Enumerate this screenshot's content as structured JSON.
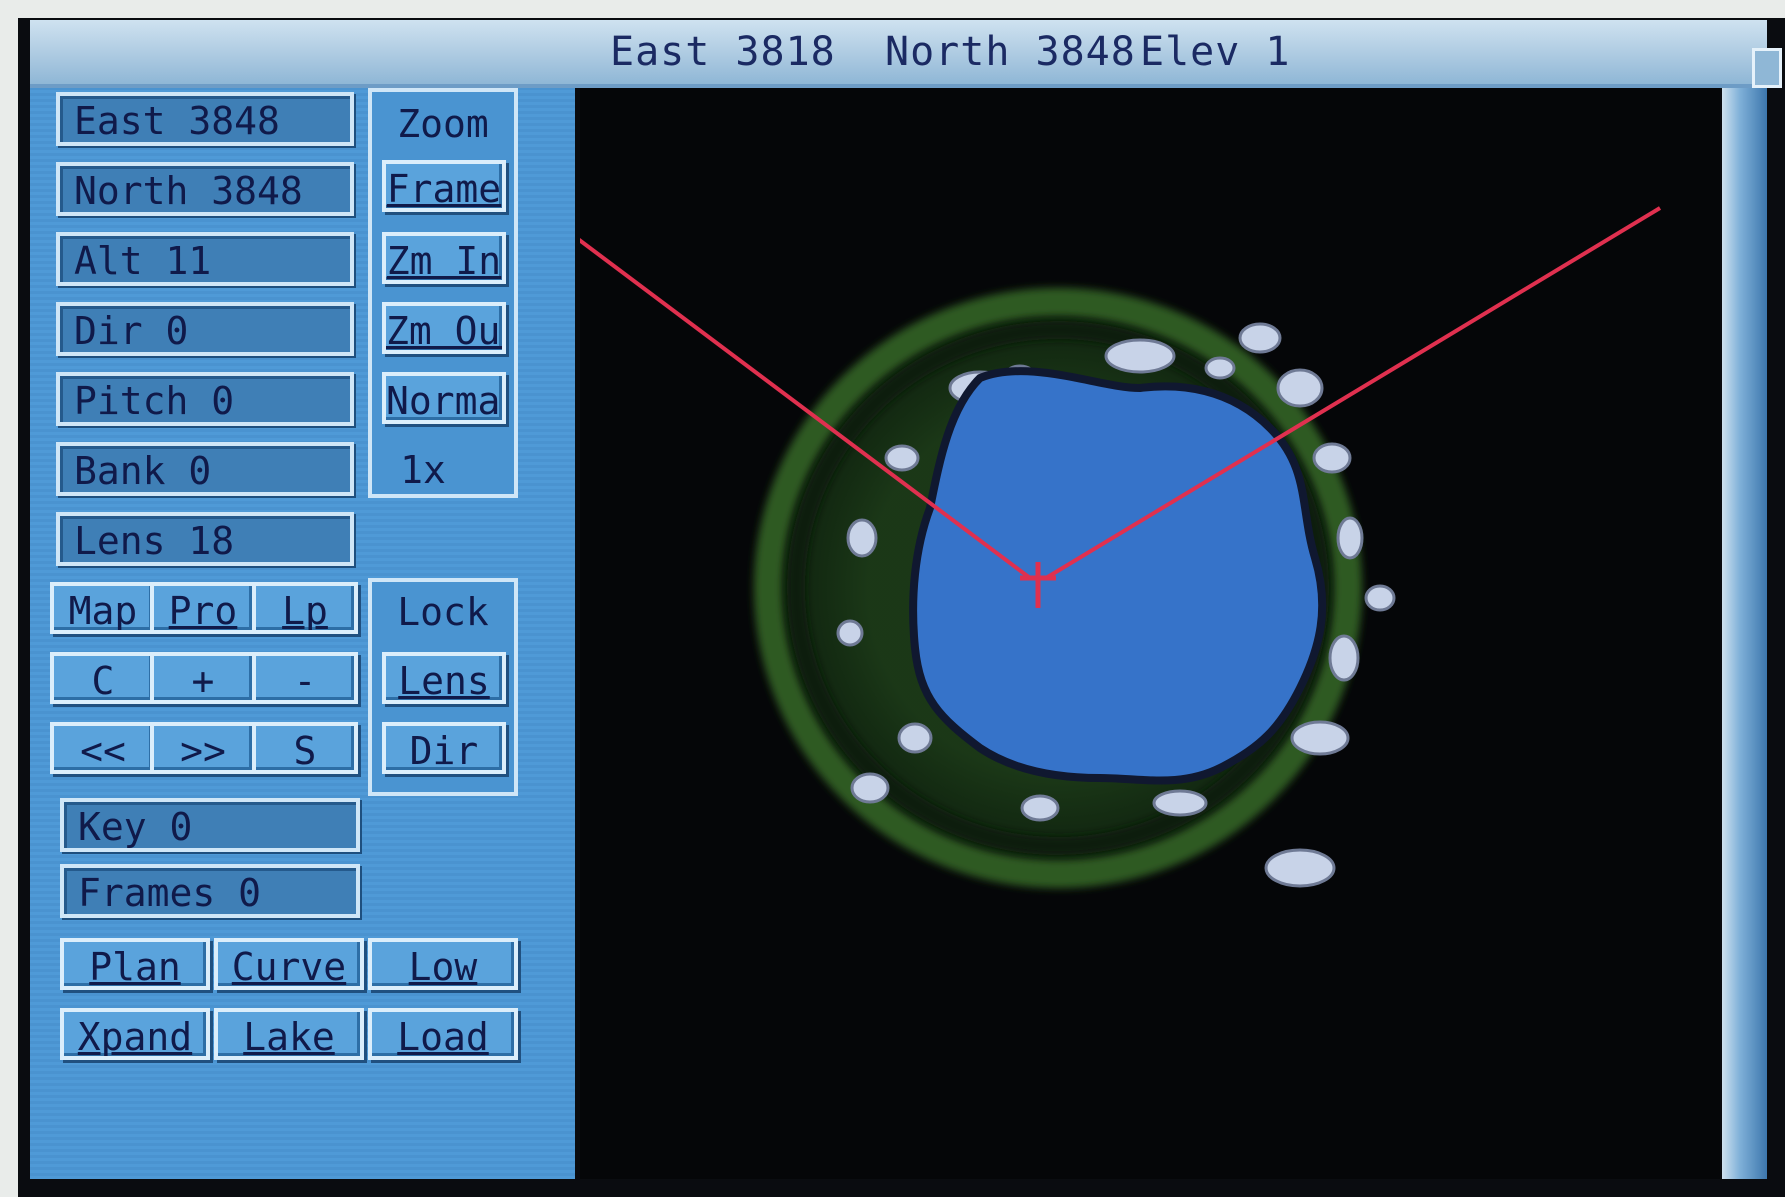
{
  "titlebar": {
    "east": "East 3818",
    "north": "North 3848",
    "elev": "Elev 1"
  },
  "fields": {
    "east": "East  3848",
    "north": "North 3848",
    "alt": "Alt   11",
    "dir": "Dir   0",
    "pitch": "Pitch 0",
    "bank": "Bank  0",
    "lens": "Lens  18",
    "key": "Key      0",
    "frames": "Frames   0"
  },
  "zoom_group": {
    "label": "Zoom",
    "frame": "Frame",
    "zoom_in": "Zm In",
    "zoom_out": "Zm Out",
    "normal": "Normal",
    "level": "1x"
  },
  "mode_buttons": {
    "map": "Map",
    "pro": "Pro",
    "lp": "Lp"
  },
  "lock_group": {
    "label": "Lock",
    "lens": "Lens",
    "dir": "Dir"
  },
  "nav_buttons": {
    "c": "C",
    "plus": "+",
    "minus": "-",
    "rewind": "<<",
    "forward": ">>",
    "s": "S"
  },
  "bottom_buttons": {
    "row1": [
      "Plan",
      "Curve",
      "Low"
    ],
    "row2": [
      "Xpand",
      "Lake",
      "Load"
    ]
  },
  "colors": {
    "panel": "#4f9ad7",
    "lake": "#3673c9",
    "view_lines": "#e0304f",
    "terrain": "#1c3a18"
  }
}
